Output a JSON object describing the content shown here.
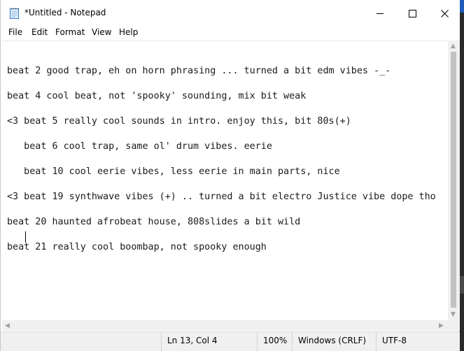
{
  "window": {
    "title": "*Untitled - Notepad",
    "minimize_icon": "minimize-icon",
    "maximize_icon": "maximize-icon",
    "close_icon": "close-icon"
  },
  "menu": {
    "items": [
      "File",
      "Edit",
      "Format",
      "View",
      "Help"
    ]
  },
  "editor": {
    "lines": [
      "",
      "beat 2 good trap, eh on horn phrasing ... turned a bit edm vibes -_-",
      "",
      "beat 4 cool beat, not 'spooky' sounding, mix bit weak",
      "",
      "<3 beat 5 really cool sounds in intro. enjoy this, bit 80s(+)",
      "",
      "   beat 6 cool trap, same ol' drum vibes. eerie",
      "",
      "   beat 10 cool eerie vibes, less eerie in main parts, nice",
      "",
      "<3 beat 19 synthwave vibes (+) .. turned a bit electro Justice vibe dope tho",
      "",
      "beat 20 haunted afrobeat house, 808slides a bit wild",
      "",
      "beat 21 really cool boombap, not spooky enough"
    ]
  },
  "status": {
    "position": "Ln 13, Col 4",
    "zoom": "100%",
    "line_ending": "Windows (CRLF)",
    "encoding": "UTF-8"
  },
  "colors": {
    "title_bg": "#ffffff",
    "status_bg": "#f0f0f0",
    "text": "#1a1a1a"
  }
}
